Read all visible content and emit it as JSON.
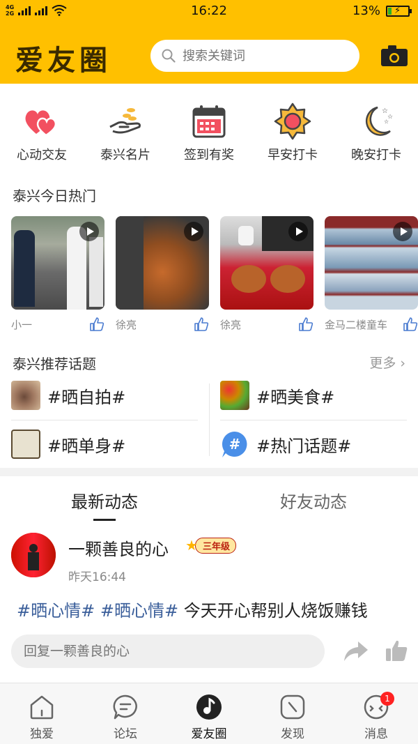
{
  "status_bar": {
    "network1": "4G",
    "network2": "2G",
    "time": "16:22",
    "battery": "13%"
  },
  "header": {
    "logo": "爱友圈",
    "search_placeholder": "搜索关键词",
    "brand_color": "#FFC000"
  },
  "features": [
    {
      "label": "心动交友",
      "icon": "double-heart-icon"
    },
    {
      "label": "泰兴名片",
      "icon": "hand-coins-icon"
    },
    {
      "label": "签到有奖",
      "icon": "calendar-icon"
    },
    {
      "label": "早安打卡",
      "icon": "sun-icon"
    },
    {
      "label": "晚安打卡",
      "icon": "moon-stars-icon"
    }
  ],
  "hot": {
    "title": "泰兴今日热门",
    "items": [
      {
        "author": "小一"
      },
      {
        "author": "徐亮"
      },
      {
        "author": "徐亮"
      },
      {
        "author": "金马二楼童车"
      }
    ]
  },
  "topics": {
    "title": "泰兴推荐话题",
    "more": "更多",
    "items": [
      {
        "label": "#晒自拍#"
      },
      {
        "label": "#晒美食#"
      },
      {
        "label": "#晒单身#"
      },
      {
        "label": "#热门话题#"
      }
    ]
  },
  "feed_tabs": {
    "latest": "最新动态",
    "friends": "好友动态"
  },
  "post": {
    "name": "一颗善良的心",
    "level_badge": "三年级",
    "time": "昨天16:44",
    "tag1": "#晒心情#",
    "tag2": "#晒心情#",
    "text": "今天开心帮别人烧饭赚钱",
    "reply_placeholder": "回复一颗善良的心"
  },
  "bottom_nav": [
    {
      "label": "独爱"
    },
    {
      "label": "论坛"
    },
    {
      "label": "爱友圈"
    },
    {
      "label": "发现"
    },
    {
      "label": "消息",
      "badge": "1"
    }
  ]
}
